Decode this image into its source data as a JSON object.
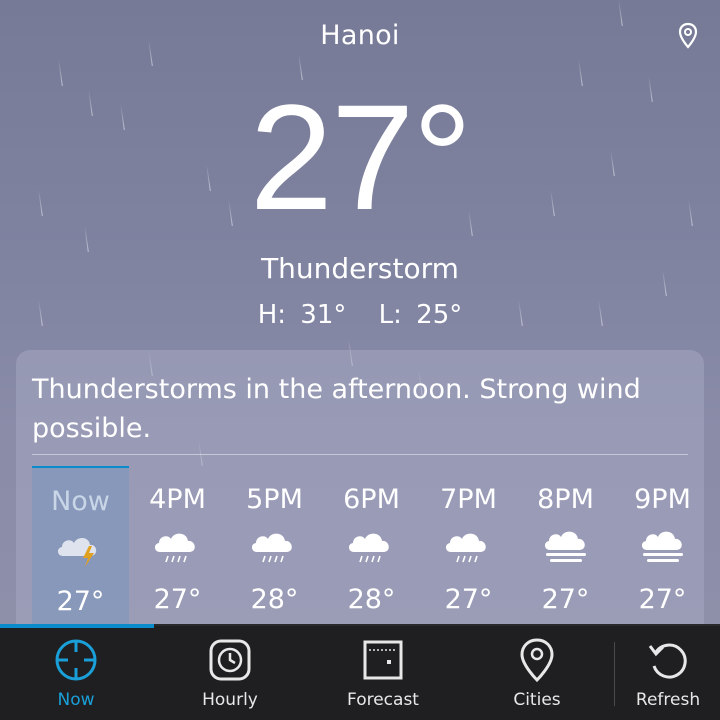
{
  "header": {
    "city": "Hanoi",
    "location_icon": "location-pin-icon"
  },
  "current": {
    "temperature": "27°",
    "condition": "Thunderstorm",
    "high": "H: 31°",
    "low": "L: 25°"
  },
  "summary": {
    "text": "Thunderstorms in the afternoon. Strong wind possible."
  },
  "hourly": [
    {
      "label": "Now",
      "icon": "cloud-lightning-icon",
      "temp": "27°"
    },
    {
      "label": "4PM",
      "icon": "cloud-rain-icon",
      "temp": "27°"
    },
    {
      "label": "5PM",
      "icon": "cloud-rain-icon",
      "temp": "28°"
    },
    {
      "label": "6PM",
      "icon": "cloud-rain-icon",
      "temp": "28°"
    },
    {
      "label": "7PM",
      "icon": "cloud-rain-icon",
      "temp": "27°"
    },
    {
      "label": "8PM",
      "icon": "cloud-fog-icon",
      "temp": "27°"
    },
    {
      "label": "9PM",
      "icon": "cloud-fog-icon",
      "temp": "27°"
    }
  ],
  "tabs": [
    {
      "label": "Now",
      "icon": "crosshair-icon",
      "active": true
    },
    {
      "label": "Hourly",
      "icon": "clock-icon",
      "active": false
    },
    {
      "label": "Forecast",
      "icon": "calendar-icon",
      "active": false
    },
    {
      "label": "Cities",
      "icon": "map-pin-icon",
      "active": false
    },
    {
      "label": "Refresh",
      "icon": "refresh-icon",
      "active": false
    }
  ],
  "colors": {
    "accent": "#0a8ccc",
    "tabbar_bg": "#1f1f21",
    "lightning": "#e0a020"
  }
}
